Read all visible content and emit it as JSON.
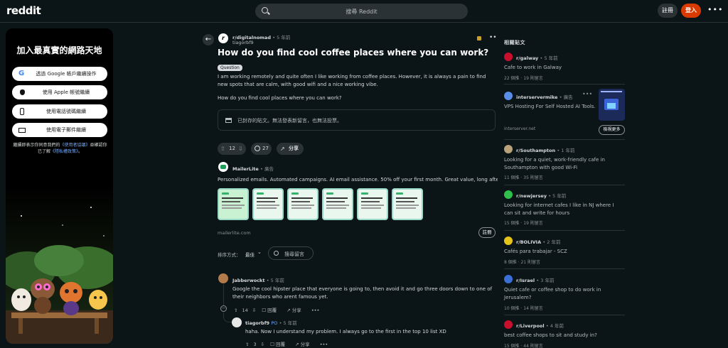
{
  "header": {
    "logo": "reddit",
    "search_placeholder": "搜尋 Reddit",
    "app_button": "註冊",
    "login_button": "登入",
    "more": "•••"
  },
  "promo": {
    "title": "加入最真實的網路天地",
    "buttons": [
      {
        "label": "透過 Google 帳戶繼續操作",
        "icon": "google-icon"
      },
      {
        "label": "使用 Apple 帳號繼續",
        "icon": "apple-icon"
      },
      {
        "label": "使用電話號碼繼續",
        "icon": "phone-icon"
      },
      {
        "label": "使用電子郵件繼續",
        "icon": "mail-icon"
      }
    ],
    "terms_prefix": "繼續即表示你同意我們的",
    "terms_link": "《使用者協議》",
    "terms_mid": "並確認你已了解",
    "privacy_link": "《隱私權政策》",
    "terms_suffix": "。"
  },
  "post": {
    "subreddit": "r/digitalnomad",
    "time": "• 5 年前",
    "author": "tiagorbf9",
    "title": "How do you find cool coffee places where you can work?",
    "flair": "Question",
    "body1": "I am working remotely and quite often I like working from coffee places. However, it is always a pain to find new spots that are calm, with good wifi and a nice working vibe.",
    "body2": "How do you find cool places where you can work?",
    "archived_notice": "已封存的貼文。無法發表新留言，也無法投票。",
    "votes": "12",
    "comments": "27",
    "share": "分享"
  },
  "ad": {
    "advertiser": "MailerLite",
    "tag": "• 廣告",
    "text": "Personalized emails. Automated campaigns. AI email assistance. 50% off your first month. Great value, long after.",
    "url": "mailerlite.com",
    "cta": "註冊"
  },
  "sort": {
    "label": "排序方式：",
    "value": "最佳",
    "search_placeholder": "搜尋留言"
  },
  "comments": [
    {
      "author": "Jabberwockt",
      "time": "• 5 年前",
      "text": "Google the cool hipster place that everyone is going to, then avoid it and go three doors down to one of their neighbors who arent famous yet.",
      "votes": "14",
      "reply": "回覆",
      "share": "分享",
      "more": "•••"
    },
    {
      "author": "tiagorbf9",
      "op": "PO",
      "time": "• 5 年前",
      "text": "haha. Now I understand my problem. I always go to the first in the top 10 list XD",
      "votes": "3",
      "reply": "回覆",
      "share": "分享",
      "more": "•••"
    }
  ],
  "sidebar": {
    "title": "相關貼文",
    "items": [
      {
        "sub": "r/galway",
        "time": "• 5 年前",
        "title": "Cafe to work in Galway",
        "stats": "22 個推 · 19 則留言",
        "color": "#c8102e"
      },
      {
        "sub": "interservermike",
        "time": "• 廣告",
        "title": "VPS Hosting For Self Hosted AI Tools.",
        "stats": "interserver.net",
        "color": "#5a8de8",
        "more": "檢視更多"
      },
      {
        "sub": "r/Southampton",
        "time": "• 1 年前",
        "title": "Looking for a quiet, work-friendly cafe in Southampton with good Wi-Fi",
        "stats": "11 個推 · 35 則留言",
        "color": "#b9a27a"
      },
      {
        "sub": "r/newjersey",
        "time": "• 5 年前",
        "title": "Looking for internet cafes I like in NJ where I can sit and write for hours",
        "stats": "15 個推 · 19 則留言",
        "color": "#2fbf4a"
      },
      {
        "sub": "r/BOLIVIA",
        "time": "• 2 年前",
        "title": "Cafés para trabajar - SCZ",
        "stats": "8 個推 · 21 則留言",
        "color": "#e6c31a"
      },
      {
        "sub": "r/Israel",
        "time": "• 3 年前",
        "title": "Quiet cafe or coffee shop to do work in Jerusalem?",
        "stats": "10 個推 · 14 則留言",
        "color": "#3b6fd6"
      },
      {
        "sub": "r/Liverpool",
        "time": "• 4 年前",
        "title": "best coffee shops to sit and study in?",
        "stats": "15 個推 · 44 則留言",
        "color": "#c8102e"
      }
    ]
  }
}
